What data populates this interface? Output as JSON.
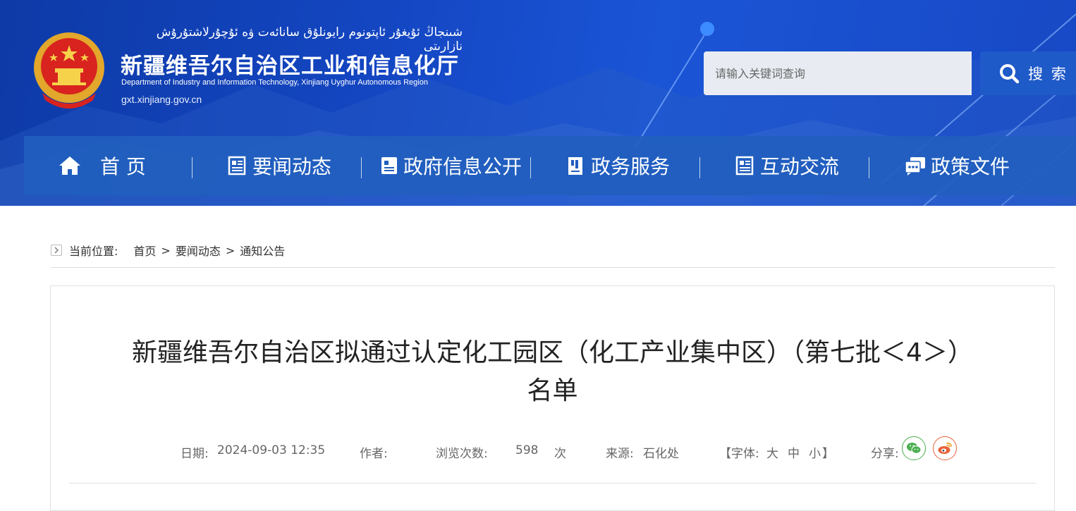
{
  "header": {
    "uyghur_title": "شىنجاڭ ئۇيغۇر ئاپتونوم رايونلۇق سانائەت ۋە ئۇچۇرلاشتۇرۇش نازارىتى",
    "title": "新疆维吾尔自治区工业和信息化厅",
    "english_title": "Department of Industry and Information Technology, Xinjiang Uyghur Autonomous Region",
    "url": "gxt.xinjiang.gov.cn",
    "emblem_icon": "national-emblem-icon"
  },
  "search": {
    "placeholder": "请输入关键词查询",
    "button_label": "搜 索"
  },
  "nav": {
    "items": [
      {
        "label": "首 页",
        "icon": "home-icon"
      },
      {
        "label": "要闻动态",
        "icon": "news-icon"
      },
      {
        "label": "政府信息公开",
        "icon": "info-icon"
      },
      {
        "label": "政务服务",
        "icon": "service-icon"
      },
      {
        "label": "互动交流",
        "icon": "interact-icon"
      },
      {
        "label": "政策文件",
        "icon": "policy-icon"
      }
    ]
  },
  "breadcrumb": {
    "label": "当前位置:",
    "items": [
      "首页",
      "要闻动态",
      "通知公告"
    ],
    "separator": ">"
  },
  "article": {
    "title_line1": "新疆维吾尔自治区拟通过认定化工园区（化工产业集中区）（第七批＜4＞）",
    "title_line2": "名单",
    "meta": {
      "date_label": "日期:",
      "date": "2024-09-03 12:35",
      "author_label": "作者:",
      "author": "",
      "views_label": "浏览次数:",
      "views": "598",
      "views_unit": "次",
      "source_label": "来源:",
      "source": "石化处",
      "font_label_open": "【字体:",
      "font_large": "大",
      "font_medium": "中",
      "font_small": "小",
      "font_label_close": "】",
      "share_label": "分享:"
    }
  },
  "colors": {
    "header_blue": "#1446c2",
    "nav_blue": "#215ebe",
    "search_button": "#1f5ac9",
    "wechat_green": "#4caf50",
    "weibo_red": "#e8613a"
  }
}
